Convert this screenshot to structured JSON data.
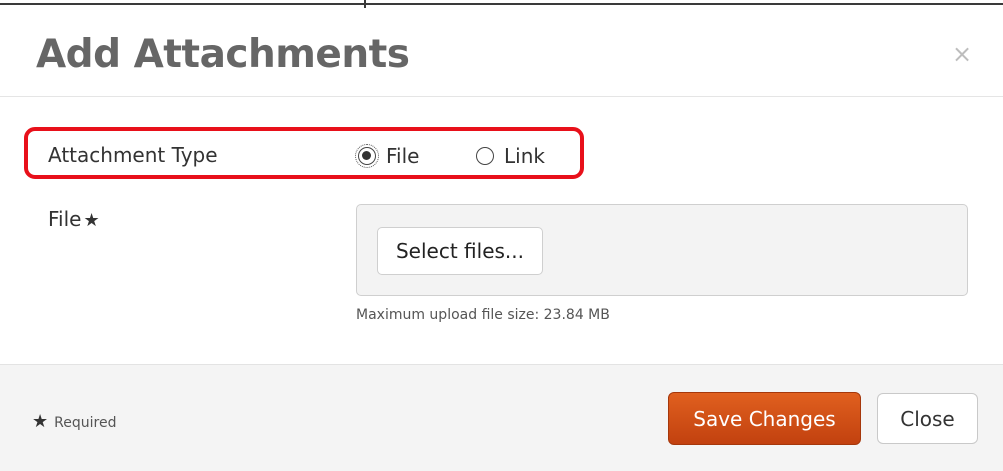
{
  "dialog": {
    "title": "Add Attachments",
    "close_icon_glyph": "×"
  },
  "form": {
    "attachment_type": {
      "label": "Attachment Type",
      "options": [
        {
          "label": "File",
          "selected": true
        },
        {
          "label": "Link",
          "selected": false
        }
      ]
    },
    "file": {
      "label": "File",
      "required_marker": "★",
      "select_button_label": "Select files...",
      "max_size_note": "Maximum upload file size: 23.84 MB"
    }
  },
  "footer": {
    "required_marker": "★",
    "required_note": "Required",
    "save_label": "Save Changes",
    "close_label": "Close"
  },
  "colors": {
    "highlight_border": "#e8101a",
    "save_button": "#cc4a14"
  },
  "icons": {
    "close": "close-icon",
    "required": "star-icon",
    "radio_selected": "radio-checked-icon",
    "radio_unselected": "radio-unchecked-icon"
  }
}
